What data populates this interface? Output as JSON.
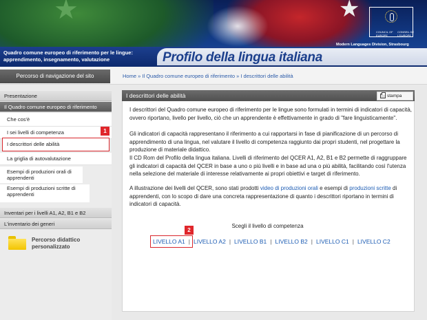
{
  "header": {
    "subtitle_line1": "Quadro comune europeo di riferimento per le lingue:",
    "subtitle_line2": "apprendimento, insegnamento, valutazione",
    "title": "Profilo della lingua italiana",
    "coe_text_left": "COUNCIL OF EUROPE",
    "coe_text_right": "CONSEIL DE L'EUROPE",
    "division": "Modern Languages Division, Strasbourg"
  },
  "nav": {
    "label": "Percorso di navigazione del sito",
    "breadcrumb": [
      "Home",
      "Il Quadro comune europeo di riferimento",
      "I descrittori delle abilità"
    ],
    "separator": "»"
  },
  "sidebar": {
    "sections": [
      {
        "label": "Presentazione"
      },
      {
        "label": "Il Quadro comune europeo di riferimento"
      }
    ],
    "items": [
      {
        "label": "Che cos'è"
      },
      {
        "label": "I sei livelli di competenza"
      },
      {
        "label": "I descrittori delle abilità"
      },
      {
        "label": "La griglia di autovalutazione"
      },
      {
        "label": "Esempi di produzioni orali di apprendenti"
      },
      {
        "label": "Esempi di produzioni scritte di apprendenti"
      }
    ],
    "bottom_sections": [
      {
        "label": "Inventari per i livelli A1, A2, B1 e B2"
      },
      {
        "label": "L'inventario dei generi"
      }
    ],
    "percorso_line1": "Percorso didattico",
    "percorso_line2": "personalizzato"
  },
  "content": {
    "title": "I descrittori delle abilità",
    "print_label": "stampa",
    "p1": "I descrittori del Quadro comune europeo di riferimento per le lingue sono formulati in termini di indicatori di capacità, ovvero riportano, livello per livello, ciò che un apprendente è effettivamente in grado di \"fare linguisticamente\".",
    "p2": "Gli indicatori di capacità rappresentano il riferimento a cui rapportarsi in fase di pianificazione di un percorso di apprendimento di una lingua, nel valutare il livello di competenza raggiunto dai propri studenti, nel progettare la produzione di materiale didattico.",
    "p3": "Il CD Rom del Profilo della lingua italiana. Livelli di riferimento del QCER A1, A2, B1 e B2 permette di raggruppare gli indicatori di capacità del QCER in base a uno o più livelli e in base ad una o più abilità, facilitando così l'utenza nella selezione del materiale di interesse relativamente ai propri obiettivi e target di riferimento.",
    "p4_pre": "A illustrazione dei livelli del QCER, sono stati prodotti ",
    "p4_link1": "video di produzioni orali",
    "p4_mid": " e esempi di ",
    "p4_link2": "produzioni scritte",
    "p4_post": " di apprendenti, con lo scopo di dare una concreta rappresentazione di quanto i descrittori riportano in termini di indicatori di capacità.",
    "choose_label": "Scegli il livello di competenza",
    "levels": [
      "LIVELLO A1",
      "LIVELLO A2",
      "LIVELLO B1",
      "LIVELLO B2",
      "LIVELLO C1",
      "LIVELLO C2"
    ],
    "level_separator": "|"
  },
  "annotations": [
    "1",
    "2"
  ]
}
